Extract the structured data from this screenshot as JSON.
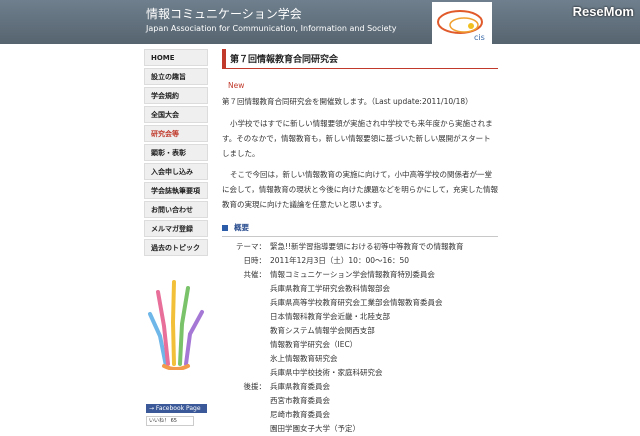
{
  "header": {
    "title": "情報コミュニケーション学会",
    "subtitle": "Japan Association for Communication, Information and Society",
    "logo_text": "cis",
    "watermark": "ReseMom"
  },
  "sidebar": {
    "items": [
      {
        "label": "HOME",
        "active": false
      },
      {
        "label": "設立の趣旨",
        "active": false
      },
      {
        "label": "学会規約",
        "active": false
      },
      {
        "label": "全国大会",
        "active": false
      },
      {
        "label": "研究会等",
        "active": true
      },
      {
        "label": "顕彰・表彰",
        "active": false
      },
      {
        "label": "入会申し込み",
        "active": false
      },
      {
        "label": "学会誌執筆要項",
        "active": false
      },
      {
        "label": "お問い合わせ",
        "active": false
      },
      {
        "label": "メルマガ登録",
        "active": false
      },
      {
        "label": "過去のトピック",
        "active": false
      }
    ],
    "facebook_label": "→ Facebook Page",
    "like_label": "いいね！ 65"
  },
  "main": {
    "heading": "第７回情報教育合同研究会",
    "news_badge": "New",
    "news_text": "第７回情報教育合同研究会を開催致します。（Last update:2011/10/18）",
    "paragraph1": "小学校ではすでに新しい情報要領が実施され中学校でも来年度から実施されます。そのなかで，情報教育も，新しい情報要領に基づいた新しい展開がスタートしました。",
    "paragraph2": "そこで今回は，新しい情報教育の実施に向けて，小中高等学校の関係者が一堂に会して，情報教育の現状と今後に向けた課題などを明らかにして，充実した情報教育の実現に向けた議論を任意たいと思います。",
    "overview_title": "概要",
    "overview": {
      "theme_label": "テーマ：",
      "theme_value": "緊急!!新学習指導要領における初等中等教育での情報教育",
      "date_label": "日時：",
      "date_value": "2011年12月3日（土）10：00〜16：50",
      "cohost_label": "共催：",
      "cohosts": [
        "情報コミュニケーション学会情報教育特別委員会",
        "兵庫県教育工学研究会教科情報部会",
        "兵庫県高等学校教育研究会工業部会情報教育委員会",
        "日本情報科教育学会近畿・北陸支部",
        "教育システム情報学会関西支部",
        "情報教育学研究会（IEC）",
        "氷上情報教育研究会",
        "兵庫県中学校技術・家庭科研究会"
      ],
      "support_label": "後援：",
      "supporters": [
        "兵庫県教育委員会",
        "西宮市教育委員会",
        "尼崎市教育委員会",
        "園田学園女子大学（予定）"
      ]
    }
  },
  "colors": {
    "header_bg": "#647381",
    "accent_red": "#c0392b",
    "section_blue": "#2a5caa",
    "facebook_blue": "#3b5998"
  }
}
